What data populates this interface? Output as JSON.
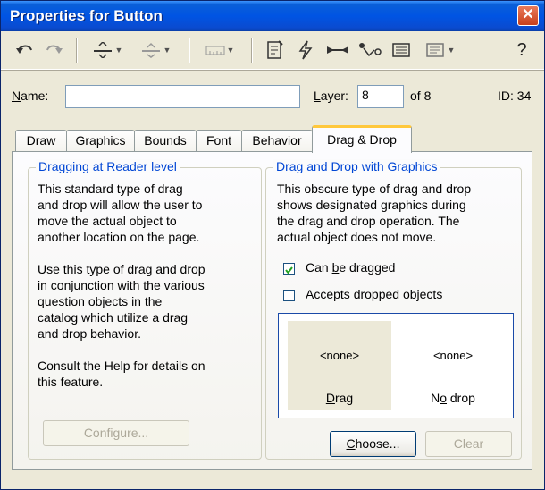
{
  "window": {
    "title": "Properties for Button",
    "close_glyph": "✕"
  },
  "toolbar": {
    "icons": [
      "undo-icon",
      "redo-icon",
      "align-icon",
      "distribute-icon",
      "ruler-icon",
      "page-icon",
      "lightning-icon",
      "link-icon",
      "connect-icon",
      "list-icon",
      "list-dropdown-icon",
      "help-icon"
    ],
    "help_label": "?"
  },
  "header": {
    "name_label": "Name:",
    "name_value": "",
    "layer_label": "Layer:",
    "layer_value": "8",
    "layer_of": "of 8",
    "id_label": "ID: 34"
  },
  "tabs": [
    "Draw",
    "Graphics",
    "Bounds",
    "Font",
    "Behavior",
    "Drag & Drop"
  ],
  "active_tab": "Drag & Drop",
  "reader_group": {
    "title": "Dragging at Reader level",
    "paragraph1": [
      "This standard type of drag",
      "and drop will allow the user to",
      "move the actual object to",
      "another location on the page."
    ],
    "paragraph2": [
      "Use this type of drag and drop",
      "in conjunction with the various",
      "question objects in the",
      "catalog which utilize a drag",
      "and drop behavior."
    ],
    "paragraph3": [
      "Consult the Help for details on",
      "this feature."
    ],
    "configure_label": "Configure..."
  },
  "graphics_group": {
    "title": "Drag and Drop with Graphics",
    "paragraph": [
      "This obscure type of drag and drop",
      "shows designated graphics during",
      "the drag and drop operation. The",
      "actual object does not move."
    ],
    "can_be_dragged_label": "Can be dragged",
    "can_be_dragged_checked": true,
    "accepts_dropped_label": "Accepts dropped objects",
    "accepts_dropped_checked": false,
    "preview": {
      "drag_value": "<none>",
      "drag_label": "Drag",
      "nodrop_value": "<none>",
      "nodrop_label": "No drop"
    },
    "choose_label": "Choose...",
    "clear_label": "Clear"
  },
  "colors": {
    "titlebar": "#0054e3",
    "group_title": "#0046d5",
    "active_tab_accent": "#ffc83c"
  }
}
